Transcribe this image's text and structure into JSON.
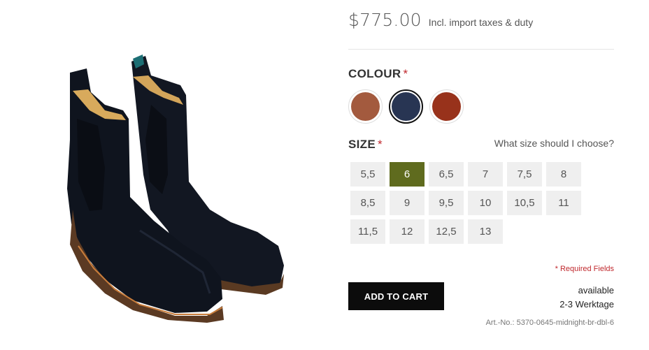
{
  "product": {
    "price": "$775.00",
    "price_note": "Incl. import taxes & duty"
  },
  "colour": {
    "title": "COLOUR",
    "required_mark": "*",
    "swatches": [
      {
        "name": "tan",
        "color": "#a35a3e",
        "selected": false
      },
      {
        "name": "midnight",
        "color": "#283553",
        "selected": true
      },
      {
        "name": "brown",
        "color": "#98321b",
        "selected": false
      }
    ]
  },
  "size": {
    "title": "SIZE",
    "required_mark": "*",
    "help_link": "What size should I choose?",
    "options": [
      "5,5",
      "6",
      "6,5",
      "7",
      "7,5",
      "8",
      "8,5",
      "9",
      "9,5",
      "10",
      "10,5",
      "11",
      "11,5",
      "12",
      "12,5",
      "13"
    ],
    "selected": "6"
  },
  "form": {
    "required_note": "* Required Fields",
    "add_to_cart": "ADD TO CART"
  },
  "availability": {
    "status": "available",
    "delivery": "2-3 Werktage"
  },
  "article": {
    "number": "Art.-No.: 5370-0645-midnight-br-dbl-6"
  },
  "colors": {
    "accent_selected_size": "#5f6b1e",
    "required_red": "#c0282d",
    "cart_button": "#0c0c0c"
  }
}
